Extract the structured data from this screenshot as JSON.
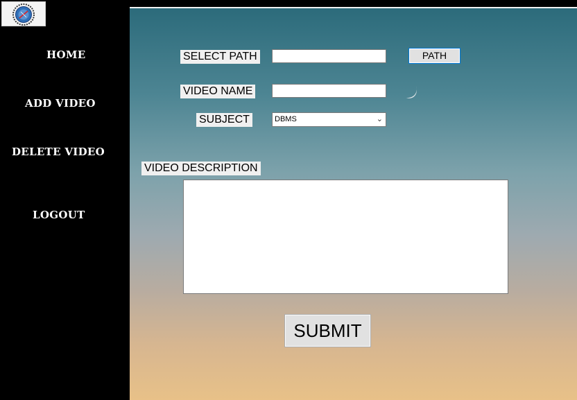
{
  "sidebar": {
    "logo_icon": "college-emblem-icon",
    "nav": {
      "home": "HOME",
      "add_video": "ADD VIDEO",
      "delete_video": "DELETE VIDEO",
      "logout": "LOGOUT"
    }
  },
  "form": {
    "select_path_label": "SELECT PATH",
    "path_value": "",
    "path_button": "PATH",
    "video_name_label": "VIDEO NAME",
    "video_name_value": "",
    "subject_label": "SUBJECT",
    "subject_selected": "DBMS",
    "description_label": "VIDEO DESCRIPTION",
    "description_value": "",
    "submit_button": "SUBMIT"
  },
  "colors": {
    "sidebar_bg": "#000000",
    "accent_border": "#0078d7"
  }
}
